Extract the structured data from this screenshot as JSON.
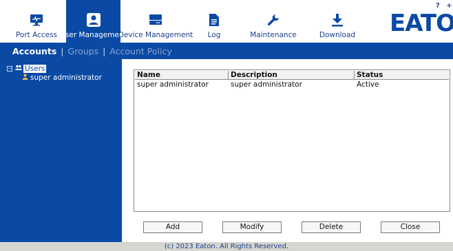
{
  "topnav": {
    "items": [
      {
        "label": "Port Access",
        "icon": "monitor-icon",
        "active": false
      },
      {
        "label": "User Management",
        "icon": "user-icon",
        "active": true
      },
      {
        "label": "Device Management",
        "icon": "device-icon",
        "active": false
      },
      {
        "label": "Log",
        "icon": "document-icon",
        "active": false
      },
      {
        "label": "Maintenance",
        "icon": "wrench-icon",
        "active": false
      },
      {
        "label": "Download",
        "icon": "download-icon",
        "active": false
      }
    ],
    "logo": "EATON",
    "help_icon": "?",
    "extra_icon": "+"
  },
  "subnav": {
    "items": [
      {
        "label": "Accounts",
        "active": true
      },
      {
        "label": "Groups",
        "active": false
      },
      {
        "label": "Account Policy",
        "active": false
      }
    ],
    "separator": "|"
  },
  "tree": {
    "expander": "−",
    "root_label": "Users",
    "children": [
      "super administrator"
    ]
  },
  "table": {
    "columns": [
      "Name",
      "Description",
      "Status"
    ],
    "rows": [
      [
        "super administrator",
        "super administrator",
        "Active"
      ]
    ]
  },
  "buttons": {
    "add": "Add",
    "modify": "Modify",
    "delete": "Delete",
    "close": "Close"
  },
  "footer": "(c) 2023 Eaton. All Rights Reserved.",
  "colors": {
    "brand_blue": "#0a4aa5",
    "nav_text": "#1d3f8c",
    "footer_bg": "#d6d6d0"
  }
}
